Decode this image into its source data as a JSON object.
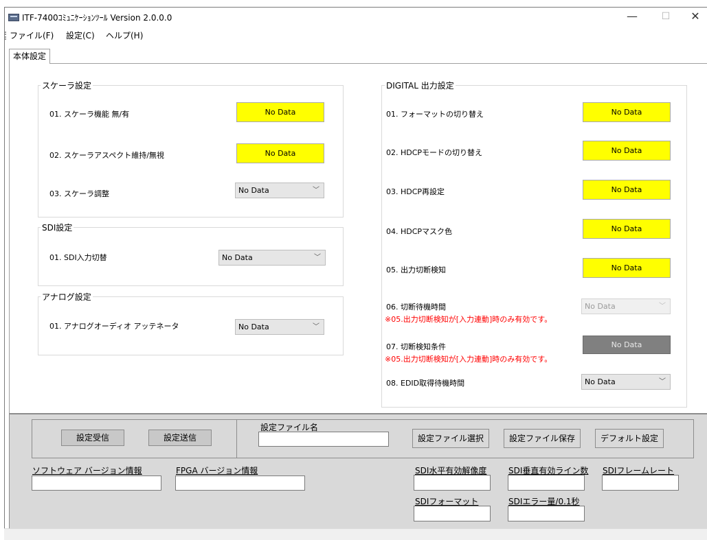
{
  "window": {
    "title": "ITF-7400ｺﾐｭﾆｹｰｼｮﾝﾂｰﾙ Version 2.0.0.0",
    "minimize": "—",
    "maximize": "☐",
    "close": "✕"
  },
  "menu": [
    "ファイル(F)",
    "設定(C)",
    "ヘルプ(H)"
  ],
  "tab": "本体設定",
  "scaler": {
    "title": "スケーラ設定",
    "rows": [
      {
        "label": "01. スケーラ機能 無/有",
        "value": "No Data"
      },
      {
        "label": "02. スケーラアスペクト維持/無視",
        "value": "No Data"
      },
      {
        "label": "03. スケーラ調整",
        "value": "No Data"
      }
    ]
  },
  "sdi": {
    "title": "SDI設定",
    "rows": [
      {
        "label": "01. SDI入力切替",
        "value": "No Data"
      }
    ]
  },
  "analog": {
    "title": "アナログ設定",
    "rows": [
      {
        "label": "01. アナログオーディオ アッテネータ",
        "value": "No Data"
      }
    ]
  },
  "digital": {
    "title": "DIGITAL 出力設定",
    "rows": [
      {
        "label": "01. フォーマットの切り替え",
        "value": "No Data"
      },
      {
        "label": "02. HDCPモードの切り替え",
        "value": "No Data"
      },
      {
        "label": "03. HDCP再設定",
        "value": "No Data"
      },
      {
        "label": "04. HDCPマスク色",
        "value": "No Data"
      },
      {
        "label": "05. 出力切断検知",
        "value": "No Data"
      },
      {
        "label": "06. 切断待機時間",
        "value": "No Data",
        "note": "※05.出力切断検知が[入力連動]時のみ有効です。"
      },
      {
        "label": "07. 切断検知条件",
        "value": "No Data",
        "note": "※05.出力切断検知が[入力連動]時のみ有効です。"
      },
      {
        "label": "08. EDID取得待機時間",
        "value": "No Data"
      }
    ]
  },
  "bottom": {
    "receive_button": "設定受信",
    "send_button": "設定送信",
    "file_name_label": "設定ファイル名",
    "file_name_value": "",
    "select_file_button": "設定ファイル選択",
    "save_file_button": "設定ファイル保存",
    "default_button": "デフォルト設定",
    "software_version_label": "ソフトウェア バージョン情報",
    "software_version_value": "",
    "fpga_version_label": "FPGA バージョン情報",
    "fpga_version_value": "",
    "sdi_h_res_label": "SDI水平有効解像度",
    "sdi_h_res_value": "",
    "sdi_v_lines_label": "SDI垂直有効ライン数",
    "sdi_v_lines_value": "",
    "sdi_frame_rate_label": "SDIフレームレート",
    "sdi_frame_rate_value": "",
    "sdi_format_label": "SDIフォーマット",
    "sdi_format_value": "",
    "sdi_error_label": "SDIエラー量/0.1秒",
    "sdi_error_value": ""
  },
  "colors": {
    "highlight": "#ffff00",
    "disabled_button": "#808080",
    "note": "#ff0000",
    "panel": "#d9d9d9"
  }
}
